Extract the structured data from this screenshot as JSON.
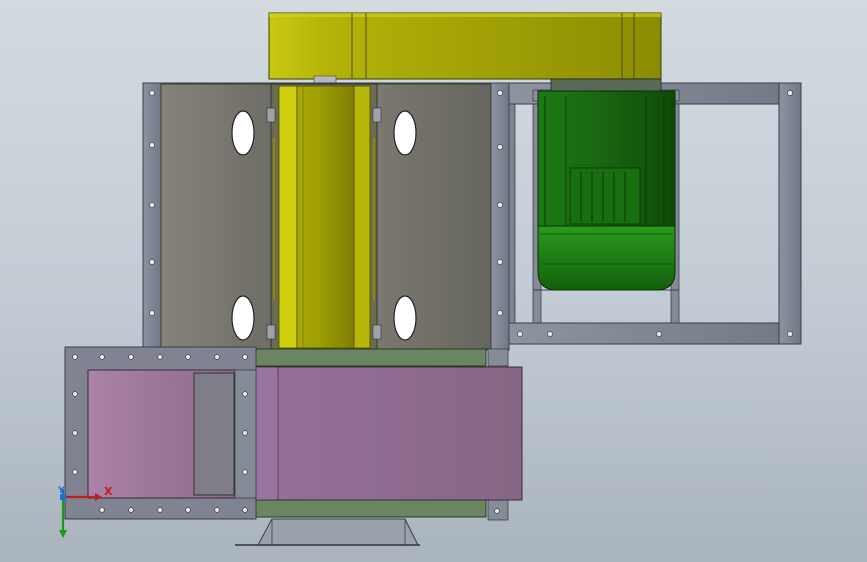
{
  "viewport": {
    "background_top": "#d3dbe1",
    "background_bottom": "#aab4bd"
  },
  "colors": {
    "frame": "#8a8f9c",
    "frame_dark": "#5b606c",
    "housing_panel": "#7a7a72",
    "belt_guard": "#b7b70a",
    "belt_guard_dark": "#8b8b05",
    "motor": "#1b6b12",
    "motor_dark": "#0f4a09",
    "duct": "#a27aa0",
    "duct_dark": "#7c5a7c",
    "rail_green": "#6f8a62"
  },
  "triad": {
    "x_label": "X",
    "y_label": "Y",
    "x_color": "#c02020",
    "y_color": "#1f6fd0",
    "z_color": "#1a9a1a"
  }
}
